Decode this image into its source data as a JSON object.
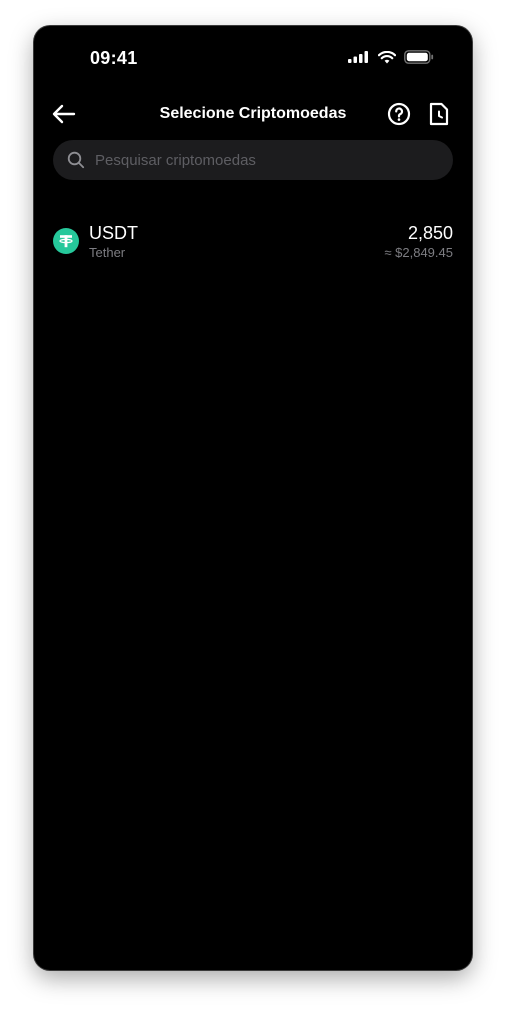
{
  "status_bar": {
    "time": "09:41",
    "icons": [
      "cellular-signal-icon",
      "wifi-icon",
      "battery-icon"
    ]
  },
  "header": {
    "title": "Selecione Criptomoedas",
    "back_icon": "arrow-left-icon",
    "help_icon": "question-circle-icon",
    "history_icon": "document-clock-icon"
  },
  "search": {
    "placeholder": "Pesquisar criptomoedas",
    "value": ""
  },
  "coins": [
    {
      "symbol": "USDT",
      "name": "Tether",
      "amount": "2,850",
      "fiat_value": "≈ $2,849.45",
      "logo_icon": "tether-logo-icon",
      "logo_color": "#26C89B"
    }
  ],
  "colors": {
    "background": "#000000",
    "search_bg": "#1C1C1E",
    "secondary_text": "#7D7D82",
    "tether_green": "#26C89B"
  }
}
